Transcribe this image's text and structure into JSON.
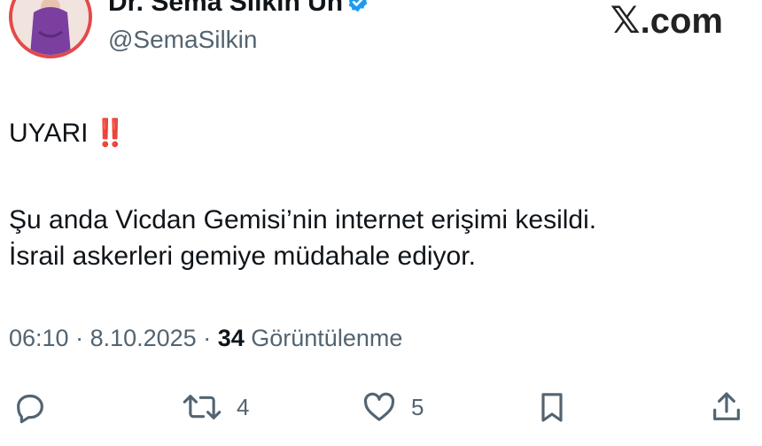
{
  "header": {
    "display_name": "Dr. Sema Silkin Ün",
    "handle": "@SemaSilkin",
    "brand_text": ".com",
    "brand_icon": "x-logo"
  },
  "tweet": {
    "line1": "UYARI",
    "line1_emoji": "‼️",
    "line2": "Şu anda Vicdan Gemisi’nin internet erişimi kesildi.",
    "line3": "İsrail askerleri gemiye müdahale ediyor."
  },
  "meta": {
    "time": "06:10",
    "separator": " · ",
    "date": "8.10.2025",
    "views_count": "34",
    "views_label": "Görüntülenme"
  },
  "actions": {
    "reply_icon": "reply-icon",
    "retweet_icon": "retweet-icon",
    "retweet_count": "4",
    "like_icon": "heart-icon",
    "like_count": "5",
    "bookmark_icon": "bookmark-icon",
    "share_icon": "share-icon"
  },
  "colors": {
    "text": "#0f1419",
    "secondary": "#536471",
    "verified": "#1d9bf0",
    "alert": "#e0242b"
  }
}
